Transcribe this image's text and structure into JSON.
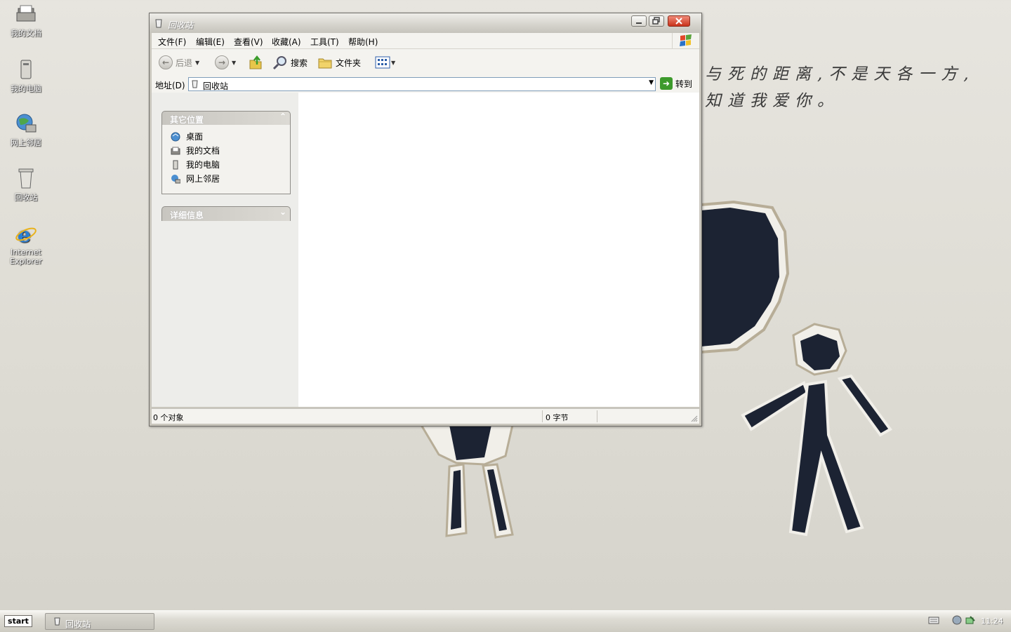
{
  "desktop": {
    "poem_line1": "与死的距离,不是天各一方,",
    "poem_line2": "知道我爱你。",
    "icons": [
      {
        "label": "我的文档",
        "icon": "my-documents-icon"
      },
      {
        "label": "我的电脑",
        "icon": "my-computer-icon"
      },
      {
        "label": "网上邻居",
        "icon": "network-places-icon"
      },
      {
        "label": "回收站",
        "icon": "recycle-bin-icon"
      },
      {
        "label": "Internet Explorer",
        "icon": "internet-explorer-icon"
      }
    ]
  },
  "window": {
    "title": "回收站",
    "menu": [
      "文件(F)",
      "编辑(E)",
      "查看(V)",
      "收藏(A)",
      "工具(T)",
      "帮助(H)"
    ],
    "toolbar": {
      "back": "后退",
      "search": "搜索",
      "folders": "文件夹"
    },
    "address": {
      "label": "地址(D)",
      "value": "回收站",
      "go": "转到"
    },
    "other_places": {
      "title": "其它位置",
      "items": [
        "桌面",
        "我的文档",
        "我的电脑",
        "网上邻居"
      ]
    },
    "details": {
      "title": "详细信息"
    },
    "status": {
      "objects": "0 个对象",
      "bytes": "0 字节"
    }
  },
  "taskbar": {
    "start": "start",
    "task": "回收站",
    "clock": "11:24"
  },
  "colors": {
    "wallpaper": "#dedcd4",
    "figure": "#1c2333",
    "title_text": "#ffffff",
    "close_button": "#c9331b",
    "go_button": "#3d9a2c"
  }
}
